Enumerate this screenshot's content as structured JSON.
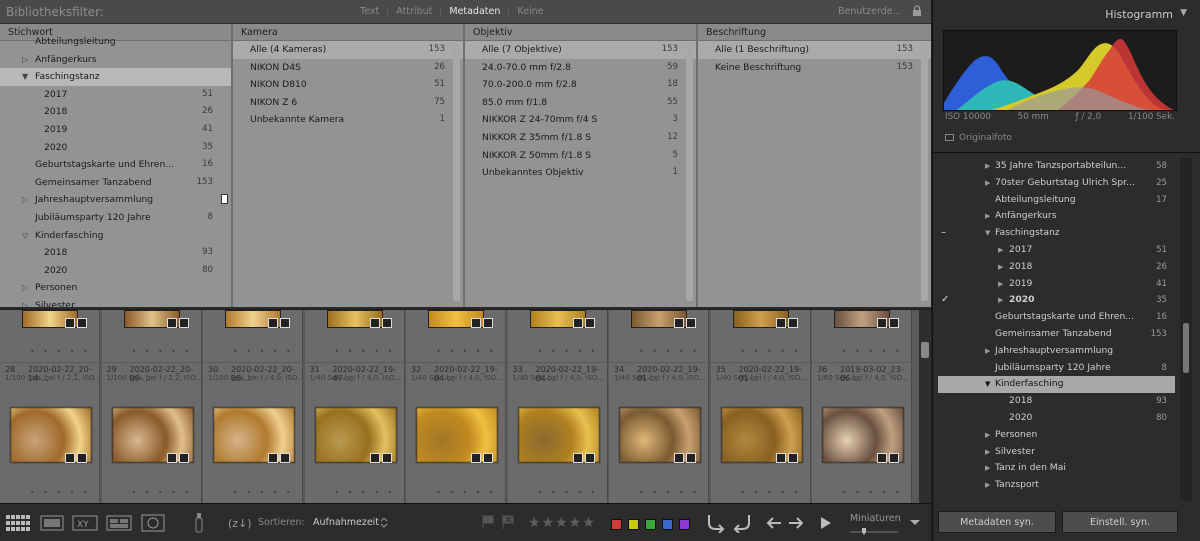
{
  "filter_bar": {
    "title": "Bibliotheksfilter:",
    "modes": [
      "Text",
      "Attribut",
      "Metadaten",
      "Keine"
    ],
    "active_mode": "Metadaten",
    "preset": "Benutzerde..."
  },
  "columns": {
    "stichwort": {
      "header": "Stichwort",
      "rows": [
        {
          "label": "Abteilungsleitung",
          "count": "",
          "tri": "",
          "indent": 1
        },
        {
          "label": "Anfängerkurs",
          "count": "",
          "tri": "▷",
          "indent": 1
        },
        {
          "label": "Faschingstanz",
          "count": "",
          "tri": "▼",
          "indent": 1,
          "selected": true
        },
        {
          "label": "2017",
          "count": "51",
          "tri": "",
          "indent": 2
        },
        {
          "label": "2018",
          "count": "26",
          "tri": "",
          "indent": 2
        },
        {
          "label": "2019",
          "count": "41",
          "tri": "",
          "indent": 2
        },
        {
          "label": "2020",
          "count": "35",
          "tri": "",
          "indent": 2
        },
        {
          "label": "Geburtstagskarte und Ehren...",
          "count": "16",
          "tri": "",
          "indent": 1
        },
        {
          "label": "Gemeinsamer Tanzabend",
          "count": "153",
          "tri": "",
          "indent": 1
        },
        {
          "label": "Jahreshauptversammlung",
          "count": "",
          "tri": "▷",
          "indent": 1
        },
        {
          "label": "Jubiläumsparty 120 Jahre",
          "count": "8",
          "tri": "",
          "indent": 1
        },
        {
          "label": "Kinderfasching",
          "count": "",
          "tri": "▽",
          "indent": 1
        },
        {
          "label": "2018",
          "count": "93",
          "tri": "",
          "indent": 2
        },
        {
          "label": "2020",
          "count": "80",
          "tri": "",
          "indent": 2
        },
        {
          "label": "Personen",
          "count": "",
          "tri": "▷",
          "indent": 1
        },
        {
          "label": "Silvester",
          "count": "",
          "tri": "▷",
          "indent": 1
        }
      ]
    },
    "kamera": {
      "header": "Kamera",
      "rows": [
        {
          "label": "Alle (4 Kameras)",
          "count": "153",
          "selected": true
        },
        {
          "label": "NIKON D4S",
          "count": "26"
        },
        {
          "label": "NIKON D810",
          "count": "51"
        },
        {
          "label": "NIKON Z 6",
          "count": "75"
        },
        {
          "label": "Unbekannte Kamera",
          "count": "1"
        }
      ]
    },
    "objektiv": {
      "header": "Objektiv",
      "rows": [
        {
          "label": "Alle (7 Objektive)",
          "count": "153",
          "selected": true
        },
        {
          "label": "24.0-70.0 mm f/2.8",
          "count": "59"
        },
        {
          "label": "70.0-200.0 mm f/2.8",
          "count": "18"
        },
        {
          "label": "85.0 mm f/1.8",
          "count": "55"
        },
        {
          "label": "NIKKOR Z 24-70mm f/4 S",
          "count": "3"
        },
        {
          "label": "NIKKOR Z 35mm f/1.8 S",
          "count": "12"
        },
        {
          "label": "NIKKOR Z 50mm f/1.8 S",
          "count": "5"
        },
        {
          "label": "Unbekanntes Objektiv",
          "count": "1"
        }
      ]
    },
    "beschriftung": {
      "header": "Beschriftung",
      "rows": [
        {
          "label": "Alle (1 Beschriftung)",
          "count": "153",
          "selected": true
        },
        {
          "label": "Keine Beschriftung",
          "count": "153"
        }
      ]
    }
  },
  "grid": {
    "cells": [
      {
        "num": "28",
        "name": "2020-02-22_20-14-...",
        "info": "1/100 Sek. bei f / 2,2, ISO..."
      },
      {
        "num": "29",
        "name": "2020-02-22_20-09-...",
        "info": "1/100 Sek. bei f / 2,2, ISO..."
      },
      {
        "num": "30",
        "name": "2020-02-22_20-08-...",
        "info": "1/100 Sek. bei f / 4,0, ISO..."
      },
      {
        "num": "31",
        "name": "2020-02-22_19-47-...",
        "info": "1/40 Sek. bei f / 4,0, ISO..."
      },
      {
        "num": "32",
        "name": "2020-02-22_19-04-...",
        "info": "1/40 Sek. bei f / 4,0, ISO..."
      },
      {
        "num": "33",
        "name": "2020-02-22_19-04-...",
        "info": "1/40 Sek. bei f / 4,0, ISO..."
      },
      {
        "num": "34",
        "name": "2020-02-22_19-01-...",
        "info": "1/40 Sek. bei f / 4,0, ISO..."
      },
      {
        "num": "35",
        "name": "2020-02-22_19-01-...",
        "info": "1/40 Sek. bei f / 4,0, ISO..."
      },
      {
        "num": "36",
        "name": "2019-03-02_23-06-...",
        "info": "1/60 Sek. bei f / 4,0, ISO..."
      }
    ]
  },
  "toolbar": {
    "sort_label": "Sortieren:",
    "sort_value": "Aufnahmezeit",
    "stars": "★★★★★",
    "color_labels": [
      "#d03a3a",
      "#c8c81e",
      "#3aa83a",
      "#3a6ad0",
      "#8a3ad0"
    ],
    "thumbnails_label": "Miniaturen"
  },
  "right_panel": {
    "histogram_title": "Histogramm",
    "iso": "ISO 10000",
    "focal": "50 mm",
    "aperture": "ƒ / 2,0",
    "shutter": "1/100 Sek.",
    "original_photo": "Originalfoto",
    "keywords": [
      {
        "label": "35 Jahre Tanzsportabteilun...",
        "count": "58",
        "tri": "▶",
        "level": 1
      },
      {
        "label": "70ster Geburtstag Ulrich Spr...",
        "count": "25",
        "tri": "▶",
        "level": 1
      },
      {
        "label": "Abteilungsleitung",
        "count": "17",
        "tri": "",
        "level": 1
      },
      {
        "label": "Anfängerkurs",
        "count": "",
        "tri": "▶",
        "level": 1
      },
      {
        "label": "Faschingstanz",
        "count": "",
        "tri": "▼",
        "level": 1,
        "mark": "–"
      },
      {
        "label": "2017",
        "count": "51",
        "tri": "▶",
        "level": 2
      },
      {
        "label": "2018",
        "count": "26",
        "tri": "▶",
        "level": 2
      },
      {
        "label": "2019",
        "count": "41",
        "tri": "▶",
        "level": 2
      },
      {
        "label": "2020",
        "count": "35",
        "tri": "▶",
        "level": 2,
        "mark": "✓",
        "bold": true
      },
      {
        "label": "Geburtstagskarte und Ehren...",
        "count": "16",
        "tri": "",
        "level": 1
      },
      {
        "label": "Gemeinsamer Tanzabend",
        "count": "153",
        "tri": "",
        "level": 1
      },
      {
        "label": "Jahreshauptversammlung",
        "count": "",
        "tri": "▶",
        "level": 1
      },
      {
        "label": "Jubiläumsparty 120 Jahre",
        "count": "8",
        "tri": "",
        "level": 1
      },
      {
        "label": "Kinderfasching",
        "count": "",
        "tri": "▼",
        "level": 1,
        "selected": true
      },
      {
        "label": "2018",
        "count": "93",
        "tri": "",
        "level": 2
      },
      {
        "label": "2020",
        "count": "80",
        "tri": "",
        "level": 2
      },
      {
        "label": "Personen",
        "count": "",
        "tri": "▶",
        "level": 1
      },
      {
        "label": "Silvester",
        "count": "",
        "tri": "▶",
        "level": 1
      },
      {
        "label": "Tanz in den Mai",
        "count": "",
        "tri": "▶",
        "level": 1
      },
      {
        "label": "Tanzsport",
        "count": "",
        "tri": "▶",
        "level": 1
      }
    ],
    "btn_metadata": "Metadaten syn.",
    "btn_settings": "Einstell. syn."
  }
}
